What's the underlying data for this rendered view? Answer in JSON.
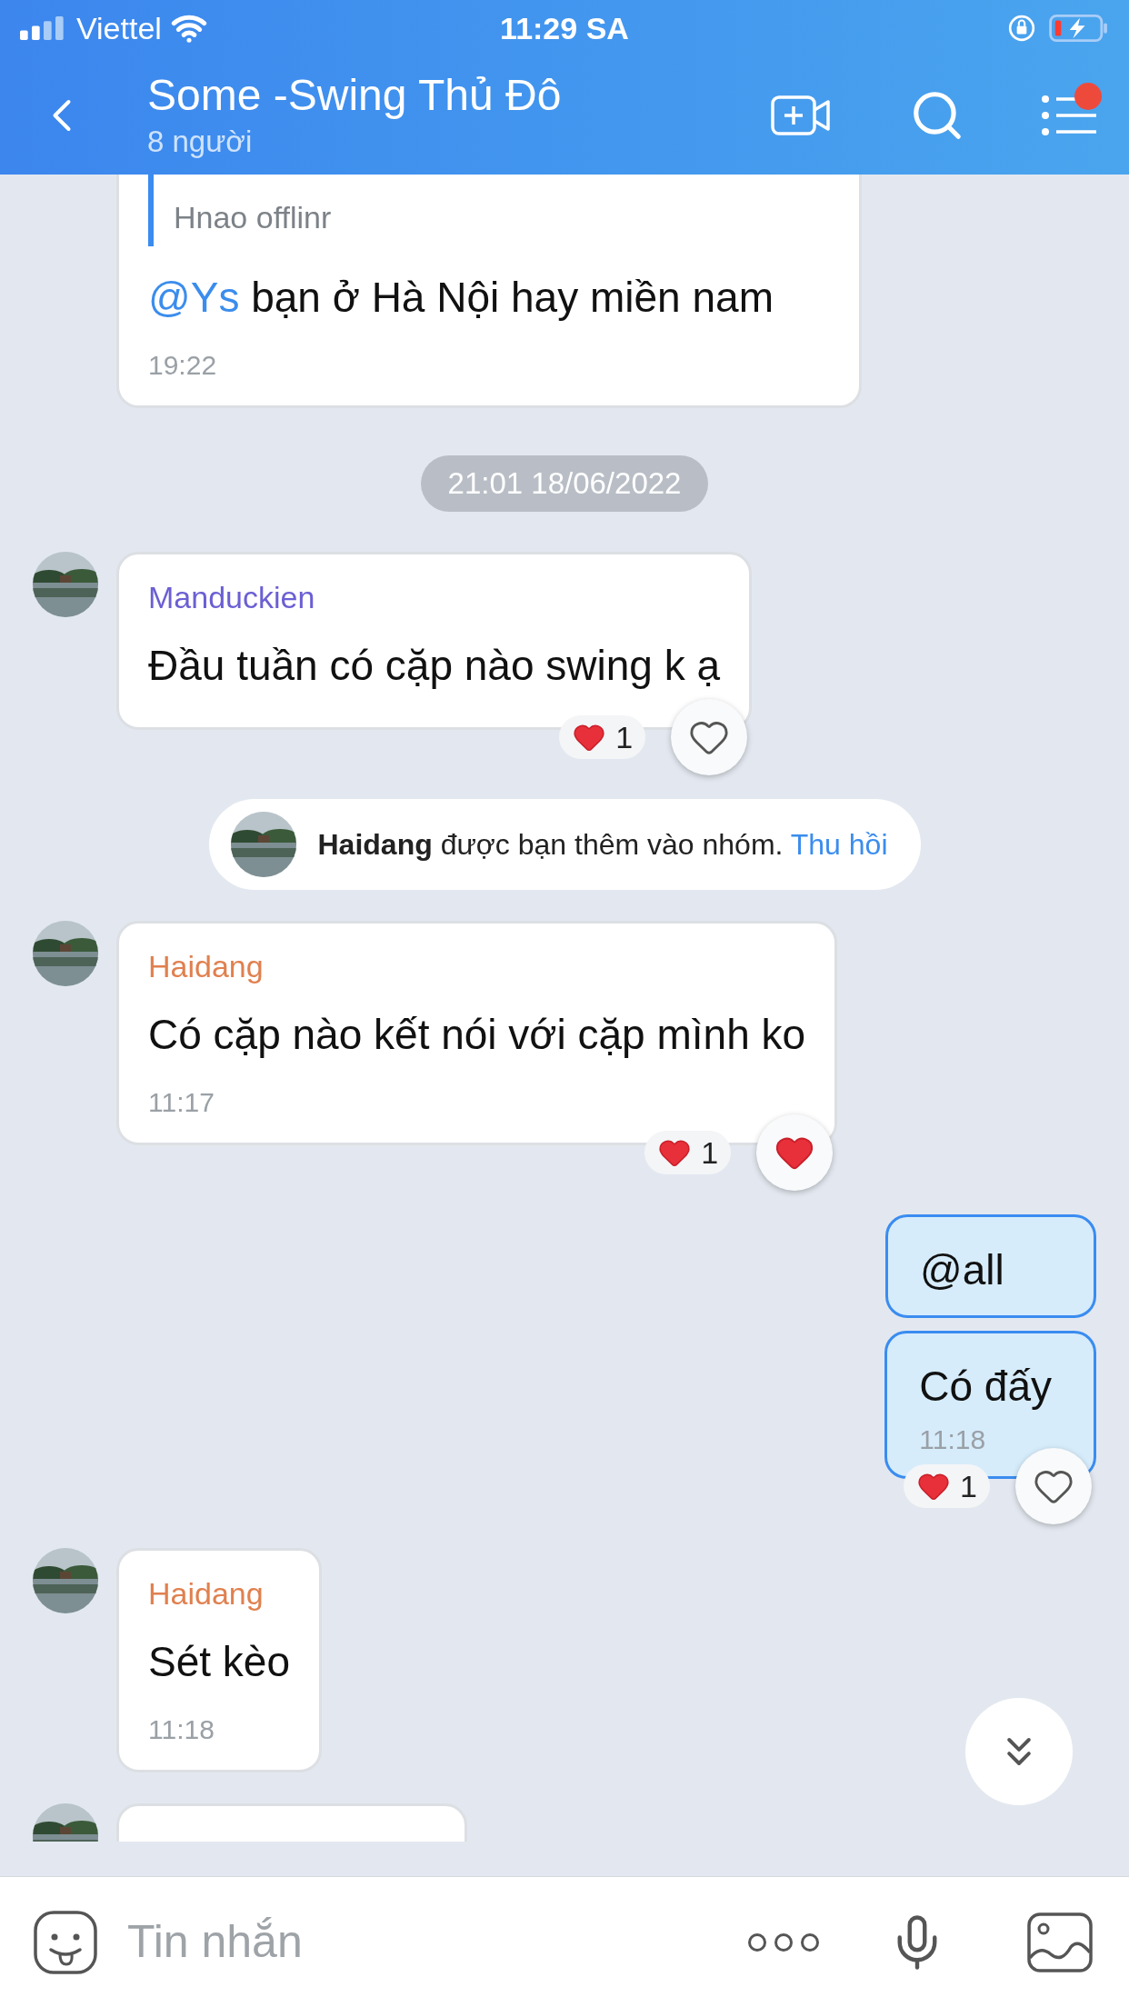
{
  "status_bar": {
    "carrier": "Viettel",
    "time": "11:29 SA"
  },
  "header": {
    "title": "Some -Swing Thủ Đô",
    "subtitle": "8 người",
    "menu_badge": true
  },
  "messages": [
    {
      "kind": "incoming",
      "quote": "Hnao offlinr",
      "mention": "@Ys",
      "text": "bạn ở Hà Nội hay miền nam",
      "time": "19:22"
    },
    {
      "kind": "date",
      "text": "21:01 18/06/2022"
    },
    {
      "kind": "incoming",
      "sender": "Manduckien",
      "color": "#6b5fd3",
      "text": "Đầu tuần có cặp nào swing k ạ",
      "reaction": {
        "count": "1",
        "reacted": false
      }
    },
    {
      "kind": "system",
      "name": "Haidang",
      "text": "được bạn thêm vào nhóm.",
      "link": "Thu hồi"
    },
    {
      "kind": "incoming",
      "sender": "Haidang",
      "color": "#e0804f",
      "text": "Có cặp nào kết nói với cặp mình ko",
      "time": "11:17",
      "reaction": {
        "count": "1",
        "reacted": true
      }
    },
    {
      "kind": "outgoing",
      "text": "@all"
    },
    {
      "kind": "outgoing",
      "text": "Có đấy",
      "time": "11:18",
      "reaction": {
        "count": "1",
        "reacted": false
      }
    },
    {
      "kind": "incoming",
      "sender": "Haidang",
      "color": "#e0804f",
      "text": "Sét kèo",
      "time": "11:18"
    },
    {
      "kind": "partial"
    }
  ],
  "composer": {
    "placeholder": "Tin nhắn"
  }
}
